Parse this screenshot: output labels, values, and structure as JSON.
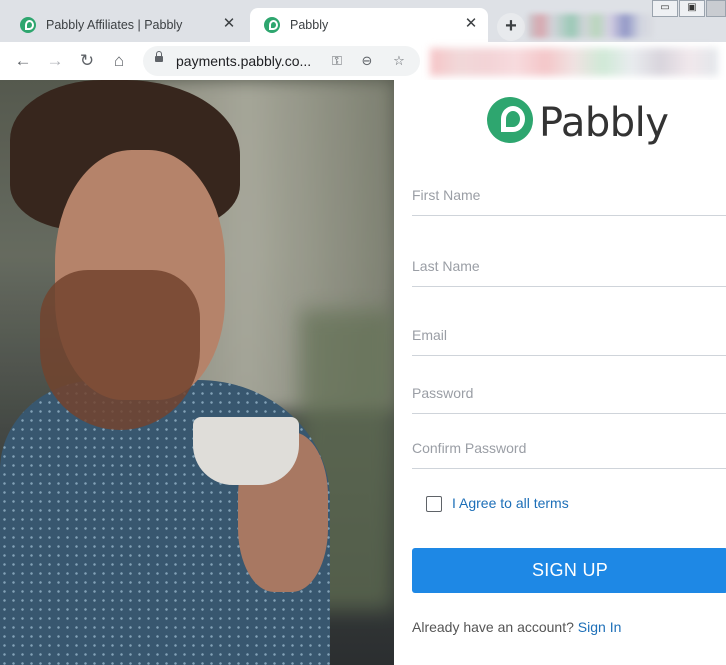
{
  "browser": {
    "tabs": [
      {
        "title": "Pabbly Affiliates | Pabbly",
        "active": false
      },
      {
        "title": "Pabbly",
        "active": true
      }
    ],
    "url": "payments.pabbly.co..."
  },
  "brand": {
    "name": "Pabbly",
    "accent": "#2ea66f"
  },
  "form": {
    "first_name_placeholder": "First Name",
    "last_name_placeholder": "Last Name",
    "email_placeholder": "Email",
    "password_placeholder": "Password",
    "confirm_password_placeholder": "Confirm Password",
    "agree_label": "I Agree to all terms",
    "agree_checked": false,
    "submit_label": "SIGN UP",
    "submit_color": "#1e88e5",
    "already_text": "Already have an account?",
    "sign_in_label": "Sign In"
  }
}
